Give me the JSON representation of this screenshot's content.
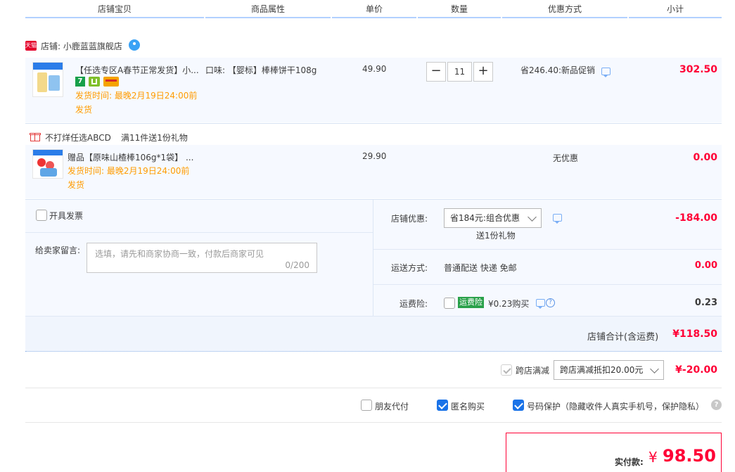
{
  "header": {
    "col_item": "店铺宝贝",
    "col_attr": "商品属性",
    "col_price": "单价",
    "col_qty": "数量",
    "col_discount": "优惠方式",
    "col_subtotal": "小计"
  },
  "shop": {
    "badge": "天猫",
    "label": "店铺: 小鹿蓝蓝旗舰店"
  },
  "item1": {
    "title": "【任选专区A春节正常发货】小...",
    "attr": "口味: 【婴标】棒棒饼干108g",
    "price": "49.90",
    "qty": "11",
    "minus": "−",
    "plus": "+",
    "ship_time": "发货时间: 最晚2月19日24:00前",
    "ship_suffix": "发货",
    "discount": "省246.40:新品促销",
    "subtotal": "302.50",
    "badge_num": "7"
  },
  "promo": {
    "label": "不打烊任选ABCD",
    "rule": "满11件送1份礼物"
  },
  "item2": {
    "title": "赠品【原味山楂棒106g*1袋】 ...",
    "price": "29.90",
    "ship_time": "发货时间: 最晚2月19日24:00前",
    "ship_suffix": "发货",
    "discount": "无优惠",
    "subtotal": "0.00"
  },
  "invoice": {
    "label": "开具发票"
  },
  "memo": {
    "label": "给卖家留言:",
    "placeholder": "选填，请先和商家协商一致，付款后商家可见",
    "counter": "0/200"
  },
  "shop_discount": {
    "label": "店铺优惠:",
    "selected": "省184元:组合优惠",
    "gift": "送1份礼物",
    "amount": "-184.00"
  },
  "shipping": {
    "label": "运送方式:",
    "value": "普通配送 快递 免邮",
    "amount": "0.00"
  },
  "insurance": {
    "label": "运费险:",
    "tag": "运费险",
    "value": "¥0.23购买",
    "amount": "0.23"
  },
  "shop_total": {
    "label": "店铺合计(含运费)",
    "amount": "¥118.50"
  },
  "cross_shop": {
    "label": "跨店满减",
    "selected": "跨店满减抵扣20.00元",
    "amount": "¥-20.00"
  },
  "options": {
    "friend_pay": "朋友代付",
    "anonymous": "匿名购买",
    "number_protect": "号码保护（隐藏收件人真实手机号，保护隐私）"
  },
  "final": {
    "label": "实付款:",
    "currency": "¥",
    "amount": "98.50"
  },
  "colors": {
    "accent_red": "#ff0036",
    "orange": "#ff9c00",
    "blue": "#1a73e8",
    "row_bg": "#f6f9ff"
  }
}
